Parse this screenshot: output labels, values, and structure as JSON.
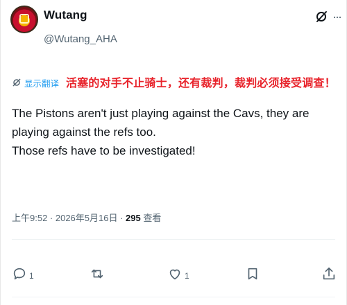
{
  "user": {
    "display_name": "Wutang",
    "handle": "@Wutang_AHA"
  },
  "translate": {
    "link_label": "显示翻译"
  },
  "annotation": "活塞的对手不止骑士，还有裁判，裁判必须接受调查！",
  "tweet": {
    "line1": "The Pistons aren't just playing against the Cavs, they are playing against the refs too.",
    "line2": "Those refs have to be investigated!"
  },
  "meta": {
    "timestamp": "上午9:52 · 2026年5月16日 · ",
    "views_count": "295",
    "views_label": " 查看"
  },
  "actions": {
    "reply_count": "1",
    "retweet_count": "",
    "like_count": "1"
  },
  "icons": {
    "accent": "#1d9bf0",
    "annotation_color": "#e8232b"
  }
}
